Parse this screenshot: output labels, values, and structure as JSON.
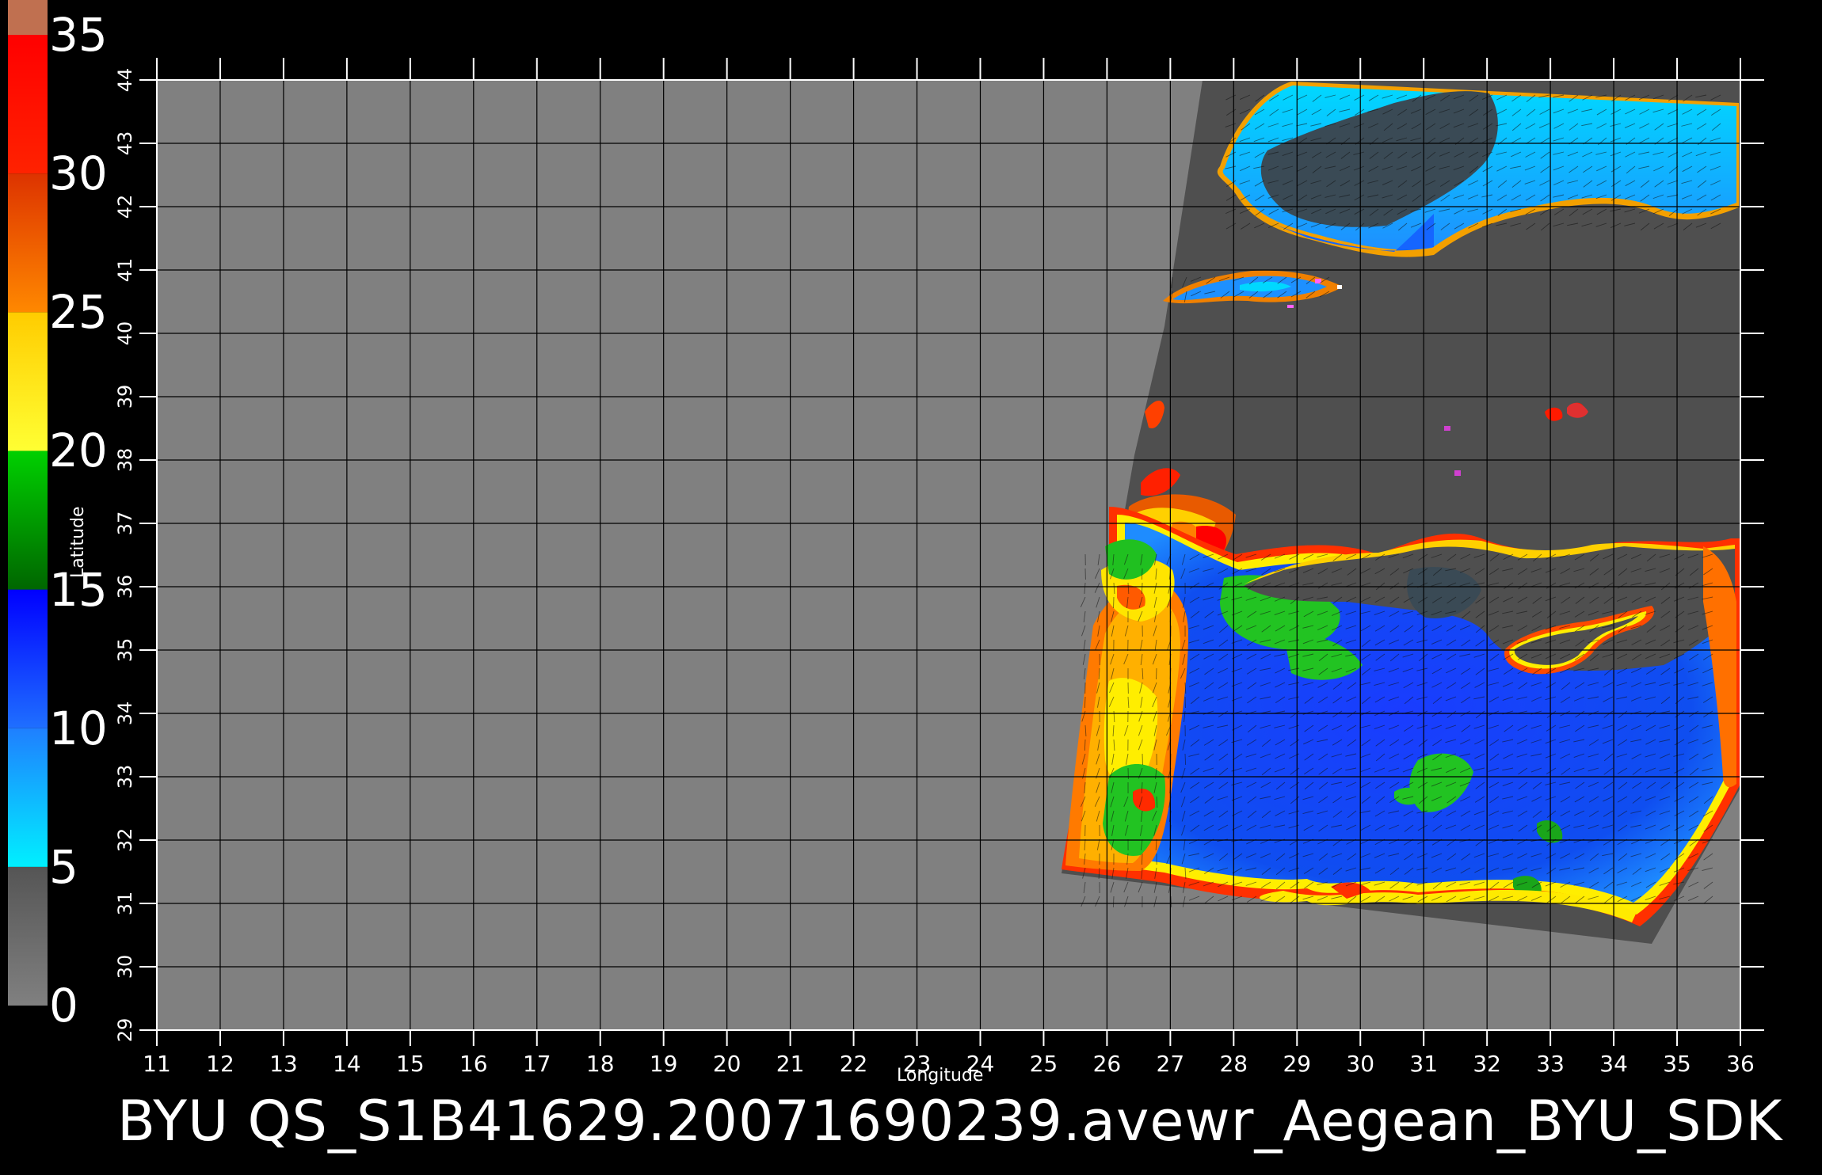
{
  "caption": "BYU  QS_S1B41629.20071690239.avewr_Aegean_BYU_SDK",
  "axes": {
    "xlabel": "Longitude",
    "ylabel": "Latitude",
    "lon_ticks": [
      "11",
      "12",
      "13",
      "14",
      "15",
      "16",
      "17",
      "18",
      "19",
      "20",
      "21",
      "22",
      "23",
      "24",
      "25",
      "26",
      "27",
      "28",
      "29",
      "30",
      "31",
      "32",
      "33",
      "34",
      "35",
      "36"
    ],
    "lat_ticks": [
      "29",
      "30",
      "31",
      "32",
      "33",
      "34",
      "35",
      "36",
      "37",
      "38",
      "39",
      "40",
      "41",
      "42",
      "43",
      "44"
    ],
    "lon_range": [
      11,
      36
    ],
    "lat_range": [
      29,
      44
    ]
  },
  "colorbar": {
    "labels": [
      "35",
      "30",
      "25",
      "20",
      "15",
      "10",
      "5",
      "0"
    ],
    "values": [
      35,
      30,
      25,
      20,
      15,
      10,
      5,
      0
    ],
    "stops": [
      {
        "from": 0,
        "to": 5,
        "color_top": "#555555",
        "color_bottom": "#808080"
      },
      {
        "from": 5,
        "to": 10,
        "color_top": "#1f7fff",
        "color_bottom": "#00f0ff"
      },
      {
        "from": 10,
        "to": 15,
        "color_top": "#0000ff",
        "color_bottom": "#1f6fff"
      },
      {
        "from": 15,
        "to": 20,
        "color_top": "#00d000",
        "color_bottom": "#006600"
      },
      {
        "from": 20,
        "to": 25,
        "color_top": "#ffcc00",
        "color_bottom": "#ffff33"
      },
      {
        "from": 25,
        "to": 30,
        "color_top": "#dd3300",
        "color_bottom": "#ff8800"
      },
      {
        "from": 30,
        "to": 35,
        "color_top": "#ff0000",
        "color_bottom": "#ff2200"
      }
    ],
    "top_swatch": "#c07050"
  },
  "colors": {
    "background": "#000000",
    "plot_background": "#808080",
    "swath_background": "#4f4f4f",
    "grid": "#000000",
    "frame": "#ffffff"
  }
}
